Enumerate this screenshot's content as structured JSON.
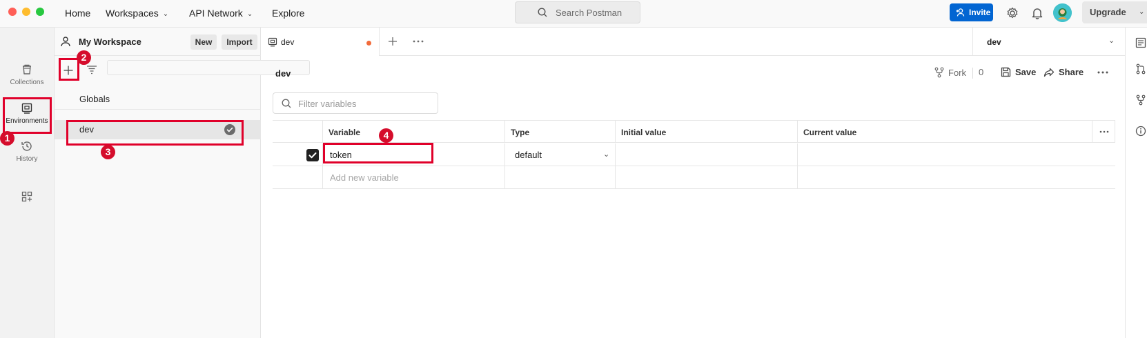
{
  "topbar": {
    "nav": {
      "home": "Home",
      "workspaces": "Workspaces",
      "api_network": "API Network",
      "explore": "Explore"
    },
    "search_placeholder": "Search Postman",
    "invite_label": "Invite",
    "upgrade_label": "Upgrade"
  },
  "rail": {
    "collections": "Collections",
    "environments": "Environments",
    "history": "History"
  },
  "sidebar": {
    "workspace_title": "My Workspace",
    "new_label": "New",
    "import_label": "Import",
    "environments": [
      {
        "label": "Globals"
      },
      {
        "label": "dev",
        "active": true
      }
    ]
  },
  "tabs": {
    "open_tab": "dev",
    "env_selector": "dev"
  },
  "editor": {
    "env_name": "dev",
    "fork_label": "Fork",
    "fork_count": "0",
    "save_label": "Save",
    "share_label": "Share",
    "filter_placeholder": "Filter variables",
    "columns": [
      "Variable",
      "Type",
      "Initial value",
      "Current value"
    ],
    "rows": [
      {
        "checked": true,
        "variable": "token",
        "type": "default",
        "initial": "",
        "current": ""
      }
    ],
    "add_placeholder": "Add new variable"
  },
  "annotations": [
    "1",
    "2",
    "3",
    "4"
  ],
  "colors": {
    "accent_blue": "#0265d2",
    "annotation_red": "#e0002a",
    "unsaved_dot": "#f26b3a"
  }
}
